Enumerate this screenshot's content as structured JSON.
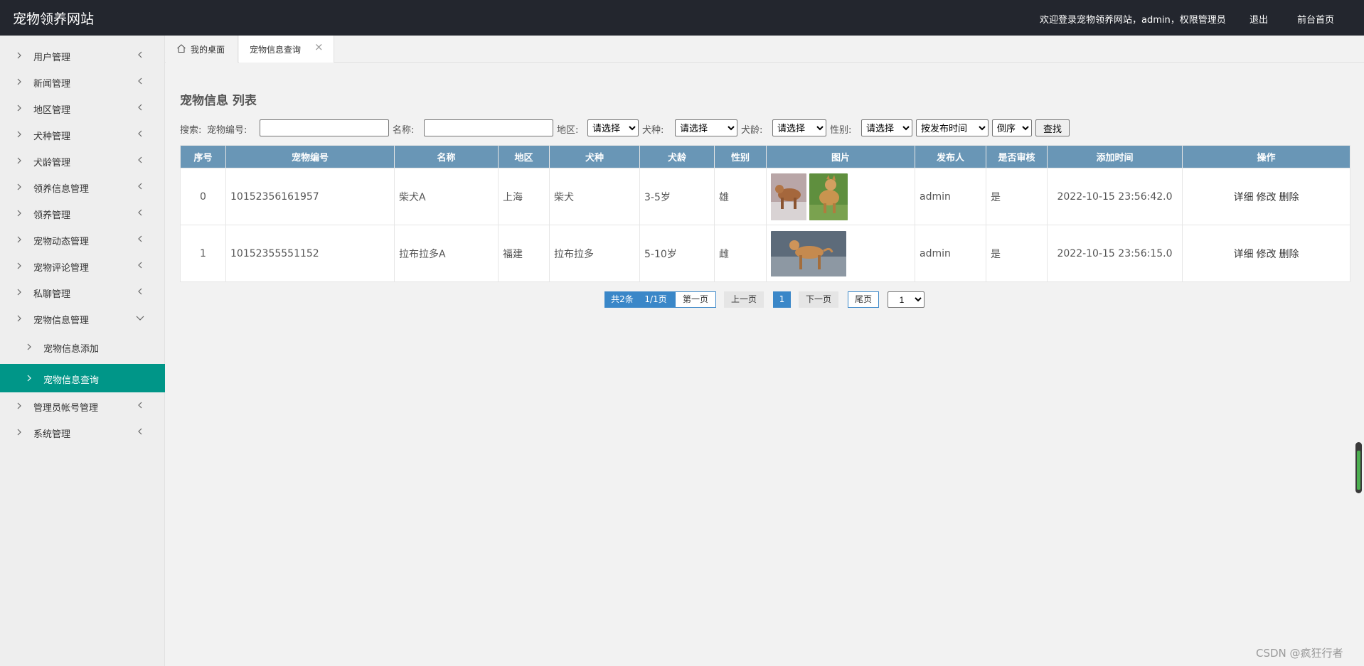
{
  "header": {
    "brand": "宠物领养网站",
    "welcome": "欢迎登录宠物领养网站，admin，权限管理员",
    "logout": "退出",
    "home": "前台首页"
  },
  "sidebar": {
    "items": [
      {
        "label": "用户管理"
      },
      {
        "label": "新闻管理"
      },
      {
        "label": "地区管理"
      },
      {
        "label": "犬种管理"
      },
      {
        "label": "犬龄管理"
      },
      {
        "label": "领养信息管理"
      },
      {
        "label": "领养管理"
      },
      {
        "label": "宠物动态管理"
      },
      {
        "label": "宠物评论管理"
      },
      {
        "label": "私聊管理"
      },
      {
        "label": "宠物信息管理"
      },
      {
        "label": "宠物信息添加"
      },
      {
        "label": "宠物信息查询"
      },
      {
        "label": "管理员帐号管理"
      },
      {
        "label": "系统管理"
      }
    ]
  },
  "tabs": [
    {
      "label": "我的桌面"
    },
    {
      "label": "宠物信息查询"
    }
  ],
  "main": {
    "title": "宠物信息 列表",
    "search": {
      "prefix": "搜索:",
      "pet_no_label": "宠物编号:",
      "pet_no_value": "",
      "name_label": "名称:",
      "name_value": "",
      "region_label": "地区:",
      "region_value": "请选择",
      "breed_label": "犬种:",
      "breed_value": "请选择",
      "age_label": "犬龄:",
      "age_value": "请选择",
      "gender_label": "性别:",
      "gender_value": "请选择",
      "sort_value": "按发布时间",
      "order_value": "倒序",
      "find_button": "查找"
    },
    "table": {
      "headers": [
        "序号",
        "宠物编号",
        "名称",
        "地区",
        "犬种",
        "犬龄",
        "性别",
        "图片",
        "发布人",
        "是否审核",
        "添加时间",
        "操作"
      ],
      "rows": [
        {
          "index": "0",
          "pet_no": "10152356161957",
          "name": "柴犬A",
          "region": "上海",
          "breed": "柴犬",
          "age": "3-5岁",
          "gender": "雄",
          "publisher": "admin",
          "approved": "是",
          "time": "2022-10-15 23:56:42.0"
        },
        {
          "index": "1",
          "pet_no": "10152355551152",
          "name": "拉布拉多A",
          "region": "福建",
          "breed": "拉布拉多",
          "age": "5-10岁",
          "gender": "雌",
          "publisher": "admin",
          "approved": "是",
          "time": "2022-10-15 23:56:15.0"
        }
      ],
      "ops": {
        "detail": "详细",
        "edit": "修改",
        "delete": "删除"
      }
    },
    "pager": {
      "total": "共2条",
      "pages": "1/1页",
      "first": "第一页",
      "prev": "上一页",
      "current": "1",
      "next": "下一页",
      "last": "尾页",
      "jump_value": "1"
    }
  },
  "watermark": "CSDN @疯狂行者",
  "colors": {
    "topbar": "#23262e",
    "active_nav": "#009688",
    "table_header": "#6996b6",
    "pager_blue": "#3a87c8"
  }
}
